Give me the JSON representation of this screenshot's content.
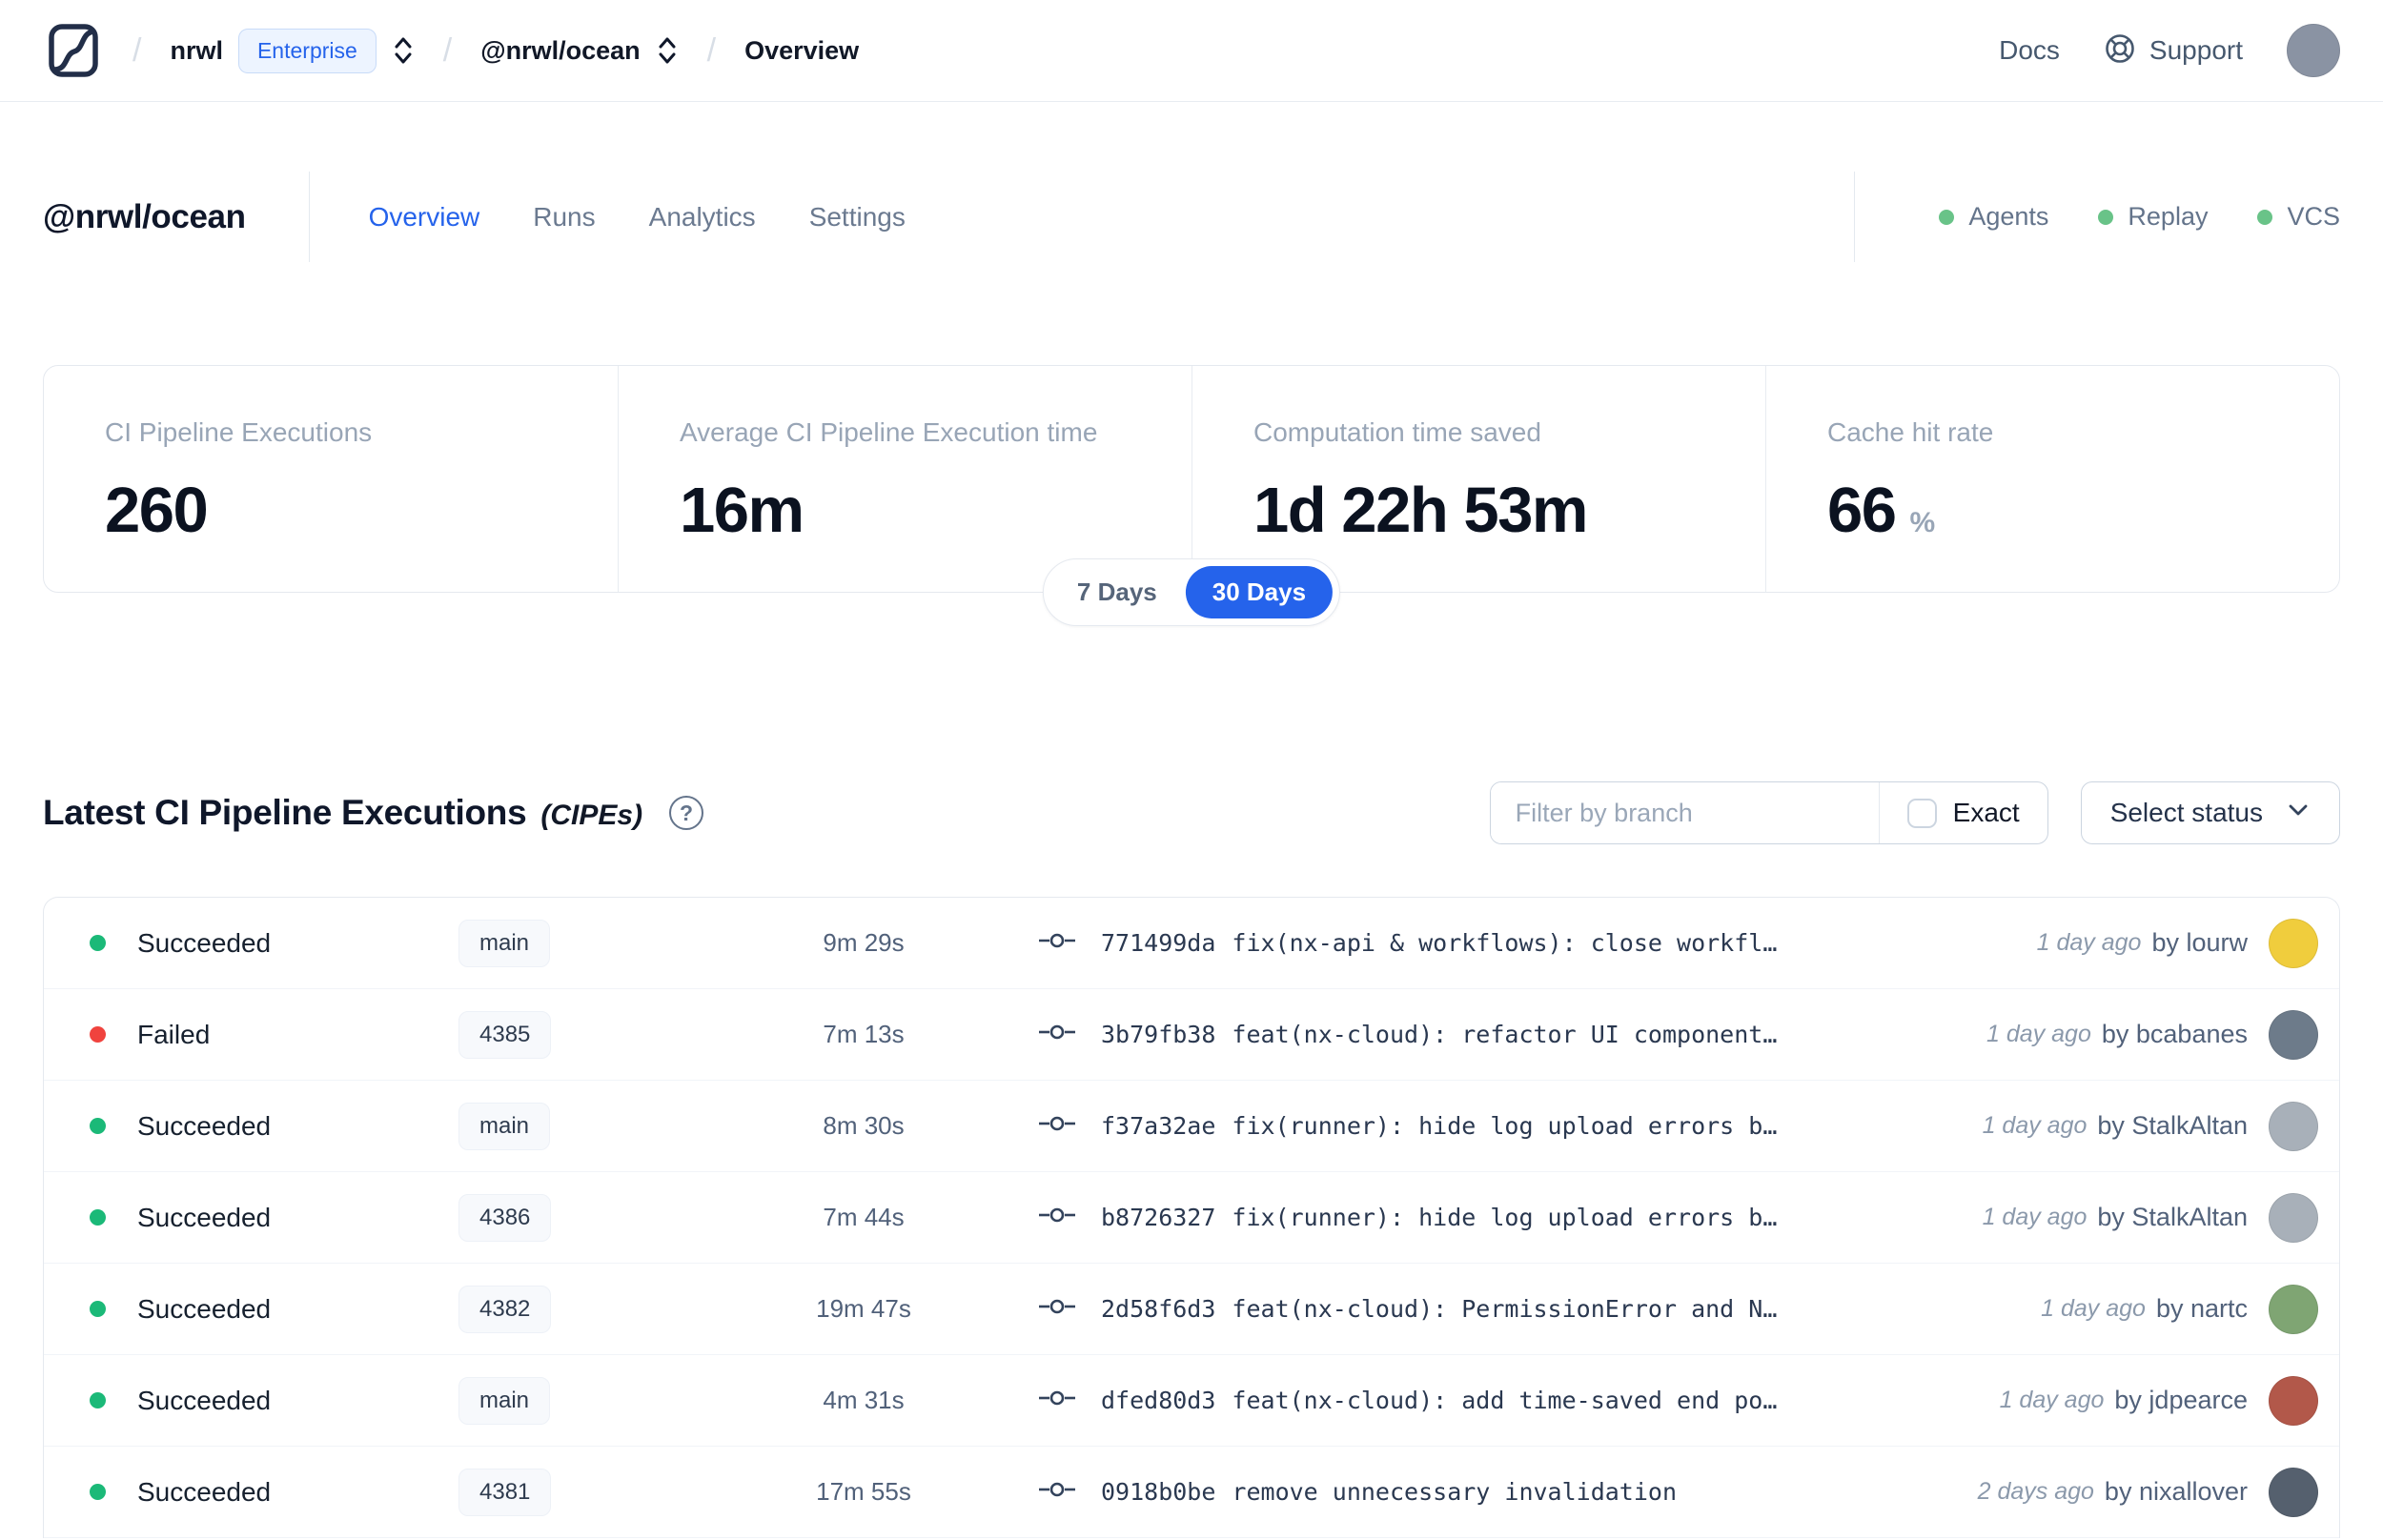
{
  "colors": {
    "accent": "#2563eb"
  },
  "nav": {
    "logo": "nx-cloud-logo",
    "breadcrumb": {
      "org": "nrwl",
      "plan_badge": "Enterprise",
      "workspace": "@nrwl/ocean",
      "page": "Overview"
    },
    "docs_label": "Docs",
    "support_label": "Support",
    "user_avatar_color": "#8a93a3"
  },
  "header": {
    "title": "@nrwl/ocean",
    "tabs": [
      {
        "label": "Overview"
      },
      {
        "label": "Runs"
      },
      {
        "label": "Analytics"
      },
      {
        "label": "Settings"
      }
    ],
    "indicators": [
      {
        "label": "Agents",
        "color": "#69c388"
      },
      {
        "label": "Replay",
        "color": "#69c388"
      },
      {
        "label": "VCS",
        "color": "#69c388"
      }
    ]
  },
  "stats": {
    "cards": [
      {
        "label": "CI Pipeline Executions",
        "value": "260",
        "unit": ""
      },
      {
        "label": "Average CI Pipeline Execution time",
        "value": "16m",
        "unit": ""
      },
      {
        "label": "Computation time saved",
        "value": "1d 22h 53m",
        "unit": ""
      },
      {
        "label": "Cache hit rate",
        "value": "66",
        "unit": "%"
      }
    ]
  },
  "period": {
    "options": [
      "7 Days",
      "30 Days"
    ],
    "selected": "30 Days",
    "accent": "#2563eb"
  },
  "cipe": {
    "title": "Latest CI Pipeline Executions",
    "title_suffix": "(CIPEs)",
    "help_icon": "?",
    "filter_placeholder": "Filter by branch",
    "exact_label": "Exact",
    "status_dropdown_label": "Select status"
  },
  "table": {
    "rows": [
      {
        "status": "Succeeded",
        "status_color": "#1bb978",
        "branch": "main",
        "duration": "9m 29s",
        "commit_hash": "771499da",
        "commit_message": "fix(nx-api & workflows): close workfl…",
        "time_ago": "1 day ago",
        "author": "by lourw",
        "avatar_color": "#f0cd3d"
      },
      {
        "status": "Failed",
        "status_color": "#f0433e",
        "branch": "4385",
        "duration": "7m 13s",
        "commit_hash": "3b79fb38",
        "commit_message": "feat(nx-cloud): refactor UI component…",
        "time_ago": "1 day ago",
        "author": "by bcabanes",
        "avatar_color": "#6d7b8a"
      },
      {
        "status": "Succeeded",
        "status_color": "#1bb978",
        "branch": "main",
        "duration": "8m 30s",
        "commit_hash": "f37a32ae",
        "commit_message": "fix(runner): hide log upload errors b…",
        "time_ago": "1 day ago",
        "author": "by StalkAltan",
        "avatar_color": "#a8b0b9"
      },
      {
        "status": "Succeeded",
        "status_color": "#1bb978",
        "branch": "4386",
        "duration": "7m 44s",
        "commit_hash": "b8726327",
        "commit_message": "fix(runner): hide log upload errors b…",
        "time_ago": "1 day ago",
        "author": "by StalkAltan",
        "avatar_color": "#a8b0b9"
      },
      {
        "status": "Succeeded",
        "status_color": "#1bb978",
        "branch": "4382",
        "duration": "19m 47s",
        "commit_hash": "2d58f6d3",
        "commit_message": "feat(nx-cloud): PermissionError and N…",
        "time_ago": "1 day ago",
        "author": "by nartc",
        "avatar_color": "#7fa573"
      },
      {
        "status": "Succeeded",
        "status_color": "#1bb978",
        "branch": "main",
        "duration": "4m 31s",
        "commit_hash": "dfed80d3",
        "commit_message": "feat(nx-cloud): add time-saved end po…",
        "time_ago": "1 day ago",
        "author": "by jdpearce",
        "avatar_color": "#b2584a"
      },
      {
        "status": "Succeeded",
        "status_color": "#1bb978",
        "branch": "4381",
        "duration": "17m 55s",
        "commit_hash": "0918b0be",
        "commit_message": "remove unnecessary invalidation",
        "time_ago": "2 days ago",
        "author": "by nixallover",
        "avatar_color": "#55606e"
      }
    ]
  }
}
